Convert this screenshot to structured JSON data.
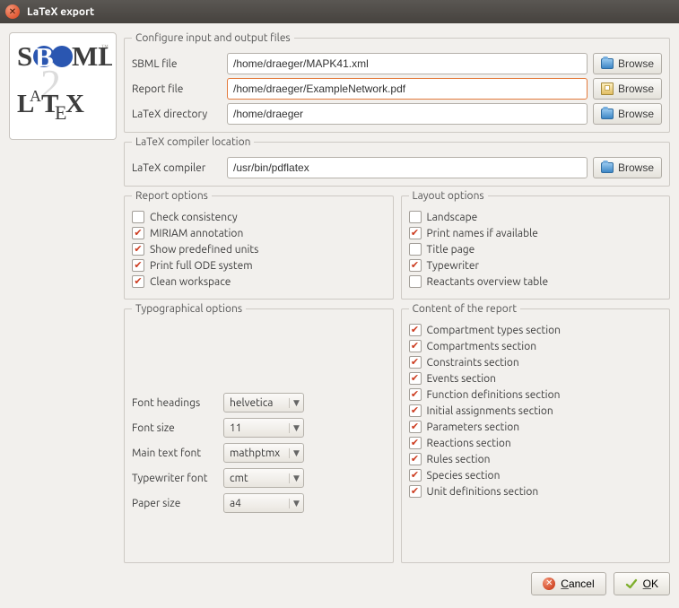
{
  "window": {
    "title": "LaTeX export"
  },
  "io": {
    "legend": "Configure input and output files",
    "sbml_label": "SBML file",
    "sbml_value": "/home/draeger/MAPK41.xml",
    "report_label": "Report file",
    "report_value": "/home/draeger/ExampleNetwork.pdf",
    "latexdir_label": "LaTeX directory",
    "latexdir_value": "/home/draeger",
    "browse": "Browse"
  },
  "compiler": {
    "legend": "LaTeX compiler location",
    "label": "LaTeX compiler",
    "value": "/usr/bin/pdflatex",
    "browse": "Browse"
  },
  "report_options": {
    "legend": "Report options",
    "items": [
      {
        "label": "Check consistency",
        "checked": false
      },
      {
        "label": "MIRIAM annotation",
        "checked": true
      },
      {
        "label": "Show predefined units",
        "checked": true
      },
      {
        "label": "Print full ODE system",
        "checked": true
      },
      {
        "label": "Clean workspace",
        "checked": true
      }
    ]
  },
  "layout_options": {
    "legend": "Layout options",
    "items": [
      {
        "label": "Landscape",
        "checked": false
      },
      {
        "label": "Print names if available",
        "checked": true
      },
      {
        "label": "Title page",
        "checked": false
      },
      {
        "label": "Typewriter",
        "checked": true
      },
      {
        "label": "Reactants overview table",
        "checked": false
      }
    ]
  },
  "typo": {
    "legend": "Typographical options",
    "font_headings_label": "Font headings",
    "font_headings_value": "helvetica",
    "font_size_label": "Font size",
    "font_size_value": "11",
    "main_font_label": "Main text font",
    "main_font_value": "mathptmx",
    "tt_font_label": "Typewriter font",
    "tt_font_value": "cmt",
    "paper_label": "Paper size",
    "paper_value": "a4"
  },
  "content": {
    "legend": "Content of the report",
    "items": [
      {
        "label": "Compartment types section",
        "checked": true
      },
      {
        "label": "Compartments section",
        "checked": true
      },
      {
        "label": "Constraints section",
        "checked": true
      },
      {
        "label": "Events section",
        "checked": true
      },
      {
        "label": "Function definitions section",
        "checked": true
      },
      {
        "label": "Initial assignments section",
        "checked": true
      },
      {
        "label": "Parameters section",
        "checked": true
      },
      {
        "label": "Reactions section",
        "checked": true
      },
      {
        "label": "Rules section",
        "checked": true
      },
      {
        "label": "Species section",
        "checked": true
      },
      {
        "label": "Unit definitions section",
        "checked": true
      }
    ]
  },
  "buttons": {
    "cancel": "Cancel",
    "ok": "OK"
  }
}
